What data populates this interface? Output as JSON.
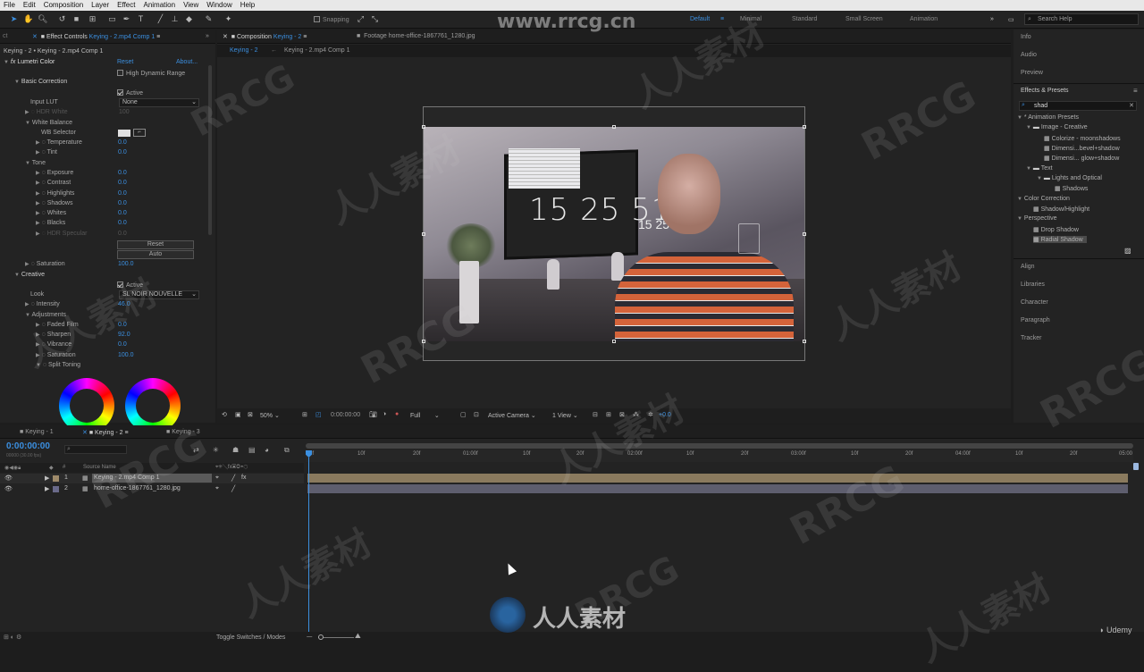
{
  "menu": [
    "File",
    "Edit",
    "Composition",
    "Layer",
    "Effect",
    "Animation",
    "View",
    "Window",
    "Help"
  ],
  "toolbar": {
    "snapping_label": "Snapping",
    "workspaces": [
      "Default",
      "Minimal",
      "Standard",
      "Small Screen",
      "Animation"
    ],
    "active_workspace": "Default",
    "search_placeholder": "Search Help"
  },
  "effect_controls": {
    "tab_label": "Effect Controls",
    "tab_target": "Keying - 2.mp4 Comp 1",
    "breadcrumb": "Keying - 2 • Keying - 2.mp4 Comp 1",
    "effect_name": "Lumetri Color",
    "reset_label": "Reset",
    "about_label": "About...",
    "hdr_label": "High Dynamic Range",
    "basic_correction": "Basic Correction",
    "active_label": "Active",
    "input_lut_label": "Input LUT",
    "input_lut_value": "None",
    "hdr_white_label": "HDR White",
    "hdr_white_value": "100",
    "white_balance": "White Balance",
    "wb_selector": "WB Selector",
    "temperature_label": "Temperature",
    "temperature_value": "0.0",
    "tint_label": "Tint",
    "tint_value": "0.0",
    "tone_label": "Tone",
    "exposure_label": "Exposure",
    "exposure_value": "0.0",
    "contrast_label": "Contrast",
    "contrast_value": "0.0",
    "highlights_label": "Highlights",
    "highlights_value": "0.0",
    "shadows_label": "Shadows",
    "shadows_value": "0.0",
    "whites_label": "Whites",
    "whites_value": "0.0",
    "blacks_label": "Blacks",
    "blacks_value": "0.0",
    "hdr_specular_label": "HDR Specular",
    "hdr_specular_value": "0.0",
    "reset_button": "Reset",
    "auto_button": "Auto",
    "saturation_label": "Saturation",
    "saturation_value": "100.0",
    "creative_label": "Creative",
    "creative_active_label": "Active",
    "look_label": "Look",
    "look_value": "SL NOIR NOUVELLE",
    "intensity_label": "Intensity",
    "intensity_value": "46.0",
    "adjustments_label": "Adjustments",
    "faded_film_label": "Faded Film",
    "faded_film_value": "0.0",
    "sharpen_label": "Sharpen",
    "sharpen_value": "92.0",
    "vibrance_label": "Vibrance",
    "vibrance_value": "0.0",
    "adj_saturation_label": "Saturation",
    "adj_saturation_value": "100.0",
    "split_toning_label": "Split Toning"
  },
  "composition": {
    "tab_label": "Composition",
    "tab_target": "Keying - 2",
    "footage_tab": "Footage home-office-1867761_1280.jpg",
    "breadcrumb_active": "Keying - 2",
    "breadcrumb_child": "Keying - 2.mp4 Comp 1",
    "clock_text": "15 25 51",
    "clock_small": "15 25",
    "zoom": "50%",
    "timecode": "0:00:00:00",
    "resolution": "Full",
    "camera": "Active Camera",
    "view": "1 View",
    "exposure": "+0.0"
  },
  "right_panel": {
    "top_items": [
      "Info",
      "Audio",
      "Preview"
    ],
    "effects_presets_title": "Effects & Presets",
    "search_value": "shad",
    "tree": [
      {
        "label": "* Animation Presets",
        "level": 0
      },
      {
        "label": "Image - Creative",
        "level": 1
      },
      {
        "label": "Colorize - moonshadows",
        "level": 2
      },
      {
        "label": "Dimensi...bevel+shadow",
        "level": 2
      },
      {
        "label": "Dimensi... glow+shadow",
        "level": 2
      },
      {
        "label": "Text",
        "level": 1
      },
      {
        "label": "Lights and Optical",
        "level": 2
      },
      {
        "label": "Shadows",
        "level": 3
      },
      {
        "label": "Color Correction",
        "level": 0
      },
      {
        "label": "Shadow/Highlight",
        "level": 1
      },
      {
        "label": "Perspective",
        "level": 0
      },
      {
        "label": "Drop Shadow",
        "level": 1
      },
      {
        "label": "Radial Shadow",
        "level": 1
      }
    ],
    "bottom_items": [
      "Align",
      "Libraries",
      "Character",
      "Paragraph",
      "Tracker"
    ]
  },
  "timeline": {
    "tabs": [
      "Keying - 1",
      "Keying - 2",
      "Keying - 3"
    ],
    "active_tab": "Keying - 2",
    "timecode": "0:00:00:00",
    "fps": "00000 (30.00 fps)",
    "source_name_header": "Source Name",
    "ruler": [
      "0f",
      "10f",
      "20f",
      "01:00f",
      "10f",
      "20f",
      "02:00f",
      "10f",
      "20f",
      "03:00f",
      "10f",
      "20f",
      "04:00f",
      "10f",
      "20f",
      "05:00"
    ],
    "layers": [
      {
        "num": "1",
        "name": "Keying - 2.mp4 Comp 1",
        "selected": true
      },
      {
        "num": "2",
        "name": "home-office-1867761_1280.jpg",
        "selected": false
      }
    ],
    "toggle_label": "Toggle Switches / Modes"
  },
  "watermark": {
    "url": "www.rrcg.cn",
    "brand": "RRCG",
    "cn": "人人素材",
    "udemy": "Udemy"
  }
}
